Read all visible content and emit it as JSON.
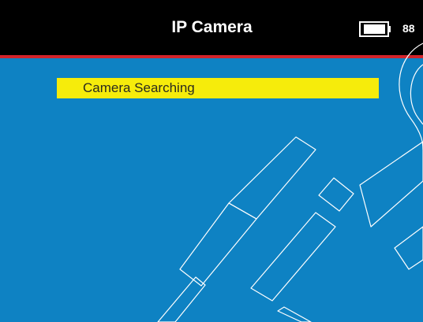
{
  "header": {
    "title": "IP Camera",
    "battery_level": "88",
    "battery_icon": "battery-icon"
  },
  "menu": {
    "items": [
      {
        "label": "Camera Searching",
        "selected": true
      }
    ]
  },
  "colors": {
    "header_bg": "#000000",
    "accent_line": "#d2232a",
    "content_bg": "#0e82c3",
    "highlight": "#f6ec0b"
  }
}
